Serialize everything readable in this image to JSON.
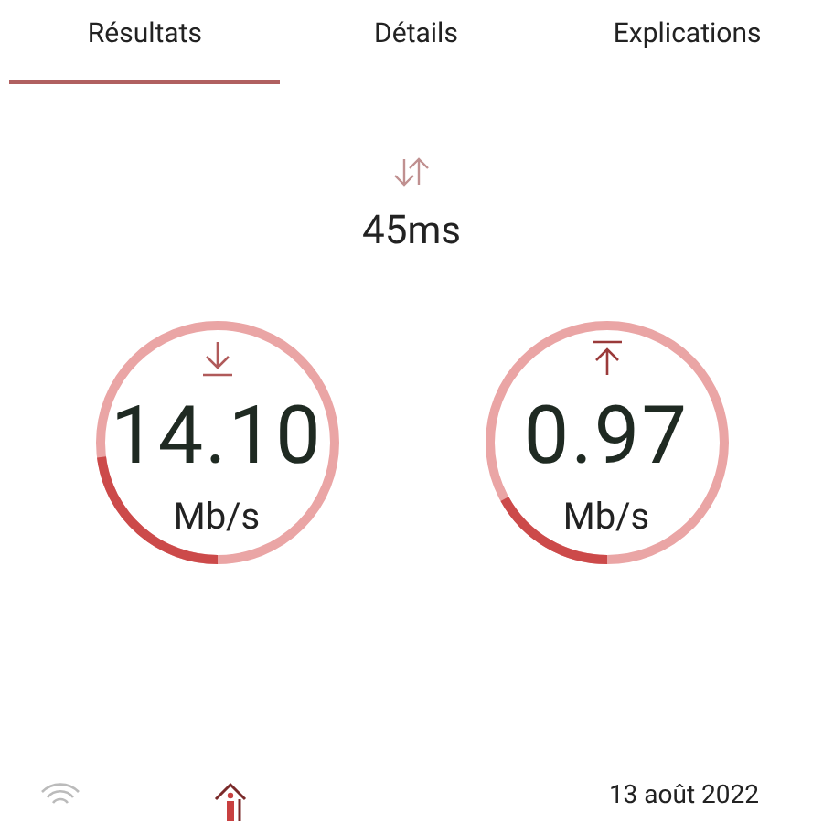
{
  "tabs": [
    {
      "label": "Résultats",
      "selected": true
    },
    {
      "label": "Détails",
      "selected": false
    },
    {
      "label": "Explications",
      "selected": false
    }
  ],
  "latency": {
    "value": "45",
    "unit": "ms"
  },
  "gauges": [
    {
      "kind": "download",
      "value": "14.10",
      "unit": "Mb/s",
      "level": 0.23
    },
    {
      "kind": "upload",
      "value": "0.97",
      "unit": "Mb/s",
      "level": 0.17
    }
  ],
  "footer": {
    "date": "13 août 2022"
  }
}
